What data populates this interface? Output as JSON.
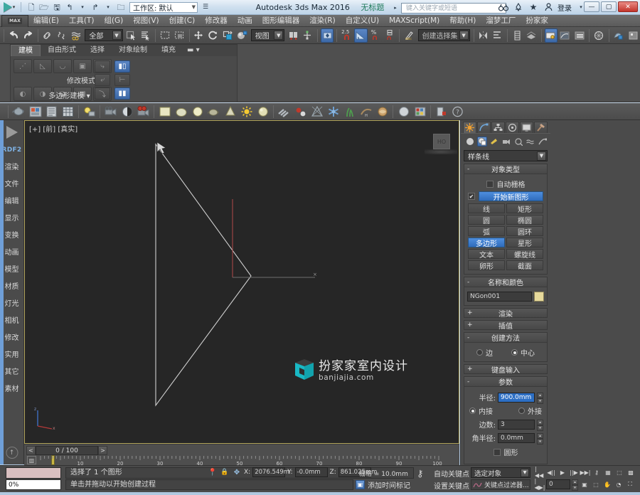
{
  "window": {
    "app_title": "Autodesk 3ds Max 2016",
    "document_title": "无标题",
    "workspace_label": "工作区: 默认",
    "search_placeholder": "键入关键字或短语",
    "login_label": "登录",
    "minimize": "—",
    "maximize": "▢",
    "close": "✕"
  },
  "quick_access": [
    {
      "name": "new-icon",
      "glyph": "🗋"
    },
    {
      "name": "open-icon",
      "glyph": "🗁"
    },
    {
      "name": "save-icon",
      "glyph": "🖫"
    },
    {
      "name": "undo-icon",
      "glyph": "↰"
    },
    {
      "name": "undo-dropdown-icon",
      "glyph": "▾"
    },
    {
      "name": "redo-icon",
      "glyph": "↱"
    },
    {
      "name": "redo-dropdown-icon",
      "glyph": "▾"
    },
    {
      "name": "set-project-folder-icon",
      "glyph": "🗀"
    }
  ],
  "title_right_icons": [
    {
      "name": "search-binoculars-icon",
      "glyph": "👀"
    },
    {
      "name": "autodesk-360-icon",
      "glyph": "⚗"
    },
    {
      "name": "favorites-star-icon",
      "glyph": "★"
    },
    {
      "name": "user-account-icon",
      "glyph": "👤"
    },
    {
      "name": "exchange-app-icon",
      "glyph": "✕"
    },
    {
      "name": "help-icon",
      "glyph": "?"
    }
  ],
  "menu": {
    "max_tab": "MAX",
    "items": [
      "编辑(E)",
      "工具(T)",
      "组(G)",
      "视图(V)",
      "创建(C)",
      "修改器",
      "动画",
      "图形编辑器",
      "渲染(R)",
      "自定义(U)",
      "MAXScript(M)",
      "帮助(H)",
      "溜梦工厂",
      "扮家家"
    ]
  },
  "main_toolbar": {
    "selection_filter": "全部",
    "reference_coord": "视图",
    "named_selection_set": "创建选择集",
    "angle_snap_value": "2.5",
    "buttons": [
      {
        "name": "undo-button",
        "glyph": "↩"
      },
      {
        "name": "redo-button",
        "glyph": "↪"
      },
      {
        "name": "select-and-link-button",
        "glyph": "🔗"
      },
      {
        "name": "unlink-selection-button",
        "glyph": "⛓"
      },
      {
        "name": "bind-to-space-warp-button",
        "glyph": "≋"
      },
      {
        "name": "select-object-button",
        "glyph": "➶"
      },
      {
        "name": "select-by-name-button",
        "glyph": "▤"
      },
      {
        "name": "rectangular-selection-region-button",
        "glyph": "▭"
      },
      {
        "name": "window-crossing-button",
        "glyph": "❐"
      },
      {
        "name": "select-and-move-button",
        "glyph": "✥"
      },
      {
        "name": "select-and-rotate-button",
        "glyph": "⟳"
      },
      {
        "name": "select-and-scale-button",
        "glyph": "◳"
      },
      {
        "name": "select-and-place-button",
        "glyph": "◕"
      },
      {
        "name": "mirror-button",
        "glyph": "▮"
      },
      {
        "name": "align-button",
        "glyph": "✛"
      },
      {
        "name": "use-center-flyout-button",
        "glyph": "◈"
      },
      {
        "name": "angle-snap-toggle-button",
        "glyph": "∠"
      },
      {
        "name": "percent-snap-toggle-button",
        "glyph": "%"
      },
      {
        "name": "spinner-snap-toggle-button",
        "glyph": "⇕"
      },
      {
        "name": "edit-named-selection-sets-button",
        "glyph": "✎"
      },
      {
        "name": "mirror-selected-objects-button",
        "glyph": "⫙"
      },
      {
        "name": "align-flyout-button",
        "glyph": "⊟"
      },
      {
        "name": "layer-explorer-button",
        "glyph": "▦"
      },
      {
        "name": "toggle-scene-explorer-button",
        "glyph": "▥"
      },
      {
        "name": "curve-editor-button",
        "glyph": "📈"
      },
      {
        "name": "schematic-view-button",
        "glyph": "🗂"
      },
      {
        "name": "material-editor-button",
        "glyph": "◍"
      },
      {
        "name": "render-setup-button",
        "glyph": "🫖"
      },
      {
        "name": "render-frame-window-button",
        "glyph": "▣"
      }
    ]
  },
  "ribbon": {
    "tabs": [
      {
        "label": "建模",
        "active": true
      },
      {
        "label": "自由形式",
        "active": false
      },
      {
        "label": "选择",
        "active": false
      },
      {
        "label": "对象绘制",
        "active": false
      },
      {
        "label": "填充",
        "active": false
      }
    ],
    "overflow_icon": "▬",
    "polygon_modeling_label": "多边形建模",
    "modify_mode_label": "修改模式",
    "row1_buttons": [
      "⋰",
      "◺",
      "◡",
      "▣",
      "⬤"
    ],
    "row2_buttons": [
      "◐",
      "◑",
      "◒",
      "▩",
      "⬤"
    ],
    "side_buttons": [
      "⤷",
      "⤶",
      "⤵"
    ],
    "right_buttons": [
      "▮▯",
      "⊢",
      "▮▮"
    ]
  },
  "object_toolbar": [
    {
      "name": "teapot-icon",
      "glyph": "🫖"
    },
    {
      "name": "material-map-icon",
      "glyph": "🖼"
    },
    {
      "name": "list-icon",
      "glyph": "▤"
    },
    {
      "name": "table-icon",
      "glyph": "▦"
    },
    {
      "name": "light-bulb-icon",
      "glyph": "💡"
    },
    {
      "name": "camera-icon",
      "glyph": "🎥"
    },
    {
      "name": "sphere-half-icon",
      "glyph": "◑"
    },
    {
      "name": "film-camera-icon",
      "glyph": "📹"
    },
    {
      "name": "box-icon",
      "glyph": "▢"
    },
    {
      "name": "sphere-gray-icon",
      "glyph": "⬬"
    },
    {
      "name": "sphere-yellow-icon",
      "glyph": "⬤"
    },
    {
      "name": "teapot-gray-icon",
      "glyph": "🫖"
    },
    {
      "name": "cone-icon",
      "glyph": "▲"
    },
    {
      "name": "sun-icon",
      "glyph": "☀"
    },
    {
      "name": "sphere-shaded-icon",
      "glyph": "⬤"
    },
    {
      "name": "hatch-icon",
      "glyph": "≋"
    },
    {
      "name": "particle-icon",
      "glyph": "⚛"
    },
    {
      "name": "helper-icon",
      "glyph": "⌖"
    },
    {
      "name": "snowflake-icon",
      "glyph": "❄"
    },
    {
      "name": "grass-icon",
      "glyph": "🌿"
    },
    {
      "name": "hair-icon",
      "glyph": "〰"
    },
    {
      "name": "cloth-icon",
      "glyph": "🍥"
    },
    {
      "name": "sphere-plain-icon",
      "glyph": "⬤"
    },
    {
      "name": "grid-color-icon",
      "glyph": "▦"
    },
    {
      "name": "export-icon",
      "glyph": "⇥"
    },
    {
      "name": "help-round-icon",
      "glyph": "?"
    }
  ],
  "left_sidebar": {
    "logo_name": "rdf-logo",
    "items": [
      "RDF2",
      "渲染",
      "文件",
      "编辑",
      "显示",
      "变换",
      "动画",
      "模型",
      "材质",
      "灯光",
      "相机",
      "修改",
      "实用",
      "其它",
      "素材"
    ],
    "bottom_icon": "↑"
  },
  "viewport": {
    "label": "[+] [前] [真实]",
    "viewcube_label": "HO",
    "watermark_title": "扮家家室内设计",
    "watermark_url": "banjiajia.com"
  },
  "trackbar": {
    "prev_frame": "<",
    "next_frame": ">",
    "current_frame": "0 / 100",
    "ticks": [
      0,
      10,
      20,
      30,
      40,
      50,
      60,
      70,
      80,
      90,
      100
    ],
    "key_icon": "▥"
  },
  "command_panel": {
    "tabs": [
      {
        "name": "create-tab",
        "glyph": "✹",
        "active": true
      },
      {
        "name": "modify-tab",
        "glyph": "◠",
        "active": false
      },
      {
        "name": "hierarchy-tab",
        "glyph": "⛬",
        "active": false
      },
      {
        "name": "motion-tab",
        "glyph": "◎",
        "active": false
      },
      {
        "name": "display-tab",
        "glyph": "▣",
        "active": false
      },
      {
        "name": "utilities-tab",
        "glyph": "🔨",
        "active": false
      }
    ],
    "subtabs": [
      {
        "name": "geometry-button",
        "glyph": "⬤",
        "active": false
      },
      {
        "name": "shapes-button",
        "glyph": "◗",
        "active": true
      },
      {
        "name": "lights-button",
        "glyph": "◤",
        "active": false
      },
      {
        "name": "cameras-button",
        "glyph": "🎥",
        "active": false
      },
      {
        "name": "helpers-button",
        "glyph": "⌗",
        "active": false
      },
      {
        "name": "space-warps-button",
        "glyph": "≋",
        "active": false
      },
      {
        "name": "systems-button",
        "glyph": "➴",
        "active": false
      }
    ],
    "category_combo": "样条线",
    "object_type": {
      "title": "对象类型",
      "auto_grid_label": "自动栅格",
      "start_new_shape_label": "开始新图形",
      "buttons": [
        "线",
        "矩形",
        "圆",
        "椭圆",
        "弧",
        "圆环",
        "多边形",
        "星形",
        "文本",
        "螺旋线",
        "卵形",
        "截面"
      ],
      "selected_button": "多边形"
    },
    "name_and_color": {
      "title": "名称和颜色",
      "object_name": "NGon001",
      "color_hex": "#e6d99b"
    },
    "rollouts": [
      {
        "title": "渲染",
        "state": "+"
      },
      {
        "title": "插值",
        "state": "+"
      }
    ],
    "creation_method": {
      "title": "创建方法",
      "state": "-",
      "options": [
        {
          "label": "边",
          "selected": false
        },
        {
          "label": "中心",
          "selected": true
        }
      ]
    },
    "keyboard_entry": {
      "title": "键盘输入",
      "state": "+"
    },
    "parameters": {
      "title": "参数",
      "state": "-",
      "radius_label": "半径:",
      "radius_value": "900.0mm",
      "inscribed_label": "内接",
      "circumscribed_label": "外接",
      "inscribed_selected": true,
      "sides_label": "边数:",
      "sides_value": "3",
      "corner_radius_label": "角半径:",
      "corner_radius_value": "0.0mm",
      "circular_label": "圆形",
      "circular_checked": false
    }
  },
  "status_bar": {
    "mr_percent": "0%",
    "selection_text": "选择了 1 个图形",
    "prompt_text": "单击并拖动以开始创建过程",
    "coord_x_label": "X:",
    "coord_x_value": "2076.549m",
    "coord_y_label": "Y:",
    "coord_y_value": "-0.0mm",
    "coord_z_label": "Z:",
    "coord_z_value": "861.025mm",
    "grid_label": "栅格 = 10.0mm",
    "add_time_tag": "添加时间标记",
    "auto_key_label": "自动关键点",
    "set_key_label": "设置关键点",
    "selection_set": "选定对象",
    "key_filters": "关键点过滤器...",
    "frame_value": "0",
    "icons": {
      "pin": "📍",
      "lock": "🔒",
      "absolute_mode": "✥",
      "key_mode": "⚷"
    },
    "playback_buttons": [
      {
        "name": "go-to-start-button",
        "glyph": "|◀◀"
      },
      {
        "name": "previous-frame-button",
        "glyph": "◀||"
      },
      {
        "name": "play-animation-button",
        "glyph": "▶"
      },
      {
        "name": "next-frame-button",
        "glyph": "||▶"
      },
      {
        "name": "go-to-end-button",
        "glyph": "▶▶|"
      },
      {
        "name": "key-mode-toggle-button",
        "glyph": "⚷"
      },
      {
        "name": "time-configuration-button",
        "glyph": "▦"
      },
      {
        "name": "zoom-extents-button",
        "glyph": "⬚"
      },
      {
        "name": "zoom-extents-all-button",
        "glyph": "▩"
      }
    ],
    "playback_buttons_row2": [
      {
        "name": "current-frame-spinner-button",
        "glyph": "|◀▶|"
      },
      {
        "name": "field-of-view-button",
        "glyph": "▣"
      },
      {
        "name": "region-zoom-button",
        "glyph": "⬚"
      },
      {
        "name": "pan-view-button",
        "glyph": "✋"
      },
      {
        "name": "orbit-button",
        "glyph": "◔"
      },
      {
        "name": "maximize-viewport-toggle-button",
        "glyph": "⛶"
      }
    ]
  }
}
